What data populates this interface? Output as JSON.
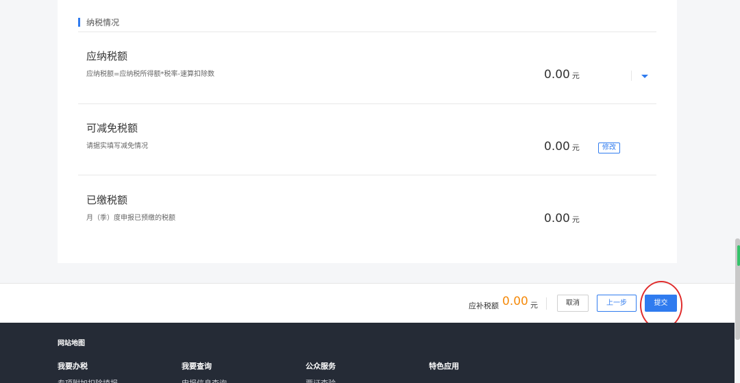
{
  "section": {
    "title": "纳税情况"
  },
  "rows": [
    {
      "title": "应纳税额",
      "desc": "应纳税额=应纳税所得额*税率-速算扣除数",
      "amount": "0.00",
      "unit": "元"
    },
    {
      "title": "可减免税额",
      "desc": "请据实填写减免情况",
      "amount": "0.00",
      "unit": "元",
      "action": "修改"
    },
    {
      "title": "已缴税额",
      "desc": "月（季）度申报已预缴的税额",
      "amount": "0.00",
      "unit": "元"
    }
  ],
  "bottom_bar": {
    "label": "应补税额",
    "amount": "0.00",
    "unit": "元",
    "cancel": "取消",
    "prev": "上一步",
    "submit": "提交"
  },
  "footer": {
    "map_title": "网站地图",
    "columns": [
      {
        "head": "我要办税",
        "link": "专项附加扣除填报"
      },
      {
        "head": "我要查询",
        "link": "申报信息查询"
      },
      {
        "head": "公众服务",
        "link": "票证查验"
      },
      {
        "head": "特色应用",
        "link": ""
      }
    ]
  },
  "colors": {
    "accent": "#2f7bef",
    "amount_highlight": "#f58a0b",
    "annotation": "#e02b2b",
    "footer_bg": "#252b36"
  }
}
